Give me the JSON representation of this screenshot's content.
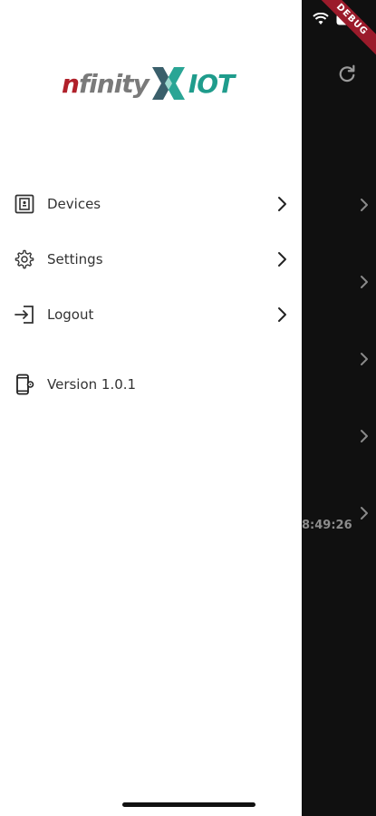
{
  "app": {
    "logo_text_n": "n",
    "logo_text_finity": "finity",
    "logo_text_iot": "IOT",
    "brand_red": "#b0202a",
    "brand_gray": "#7a7a7a",
    "brand_teal": "#1f9c8c"
  },
  "debug_banner": "DEBUG",
  "drawer": {
    "items": [
      {
        "label": "Devices",
        "icon": "device-icon"
      },
      {
        "label": "Settings",
        "icon": "gear-icon"
      },
      {
        "label": "Logout",
        "icon": "logout-icon"
      }
    ],
    "version_label": "Version 1.0.1"
  },
  "background": {
    "time_text": "8:49:26"
  }
}
